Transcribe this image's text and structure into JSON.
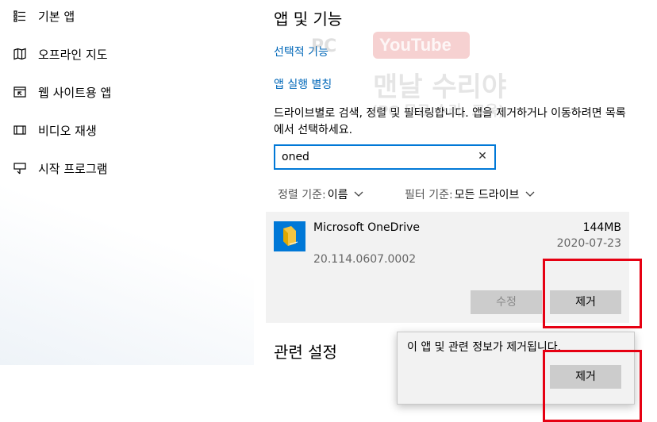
{
  "sidebar": {
    "items": [
      {
        "label": "기본 앱",
        "icon": "default-apps-icon"
      },
      {
        "label": "오프라인 지도",
        "icon": "map-icon"
      },
      {
        "label": "웹 사이트용 앱",
        "icon": "web-app-icon"
      },
      {
        "label": "비디오 재생",
        "icon": "video-icon"
      },
      {
        "label": "시작 프로그램",
        "icon": "startup-icon"
      }
    ]
  },
  "main": {
    "title": "앱 및 기능",
    "link_optional_features": "선택적 기능",
    "link_app_aliases": "앱 실행 별칭",
    "description": "드라이브별로 검색, 정렬 및 필터링합니다. 앱을 제거하거나 이동하려면 목록에서 선택하세요.",
    "search": {
      "value": "oned"
    },
    "sort": {
      "label": "정렬 기준:",
      "value": "이름"
    },
    "filter": {
      "label": "필터 기준:",
      "value": "모든 드라이브"
    },
    "app": {
      "name": "Microsoft OneDrive",
      "size": "144MB",
      "date": "2020-07-23",
      "version": "20.114.0607.0002",
      "modify_label": "수정",
      "uninstall_label": "제거"
    },
    "related_settings": "관련 설정"
  },
  "flyout": {
    "message": "이 앱 및 관련 정보가 제거됩니다.",
    "uninstall_label": "제거"
  },
  "watermark": {
    "logo_text": "YouTube",
    "channel": "맨날 수리야",
    "subtitle": "(PC 무료 수리, 교육)",
    "badge": "PC"
  },
  "colors": {
    "accent": "#0078d7",
    "link": "#0067b8",
    "highlight": "#e60012"
  }
}
